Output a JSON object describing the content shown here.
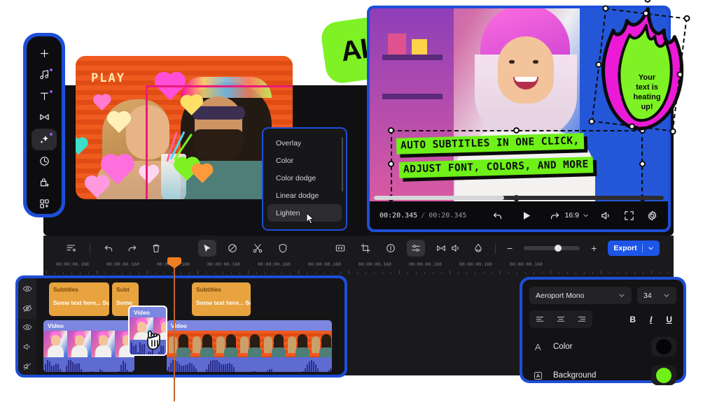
{
  "app": {
    "name": "video-editor"
  },
  "sidebar": {
    "items": [
      {
        "name": "add",
        "icon": "plus-icon"
      },
      {
        "name": "audio",
        "icon": "music-note-icon"
      },
      {
        "name": "titles",
        "icon": "text-icon"
      },
      {
        "name": "transitions",
        "icon": "transitions-icon"
      },
      {
        "name": "effects",
        "icon": "sparkles-icon"
      },
      {
        "name": "speed",
        "icon": "clock-icon"
      },
      {
        "name": "stickers",
        "icon": "sticker-icon"
      },
      {
        "name": "more",
        "icon": "apps-grid-icon"
      }
    ]
  },
  "preview_left": {
    "overlay_text": "PLAY",
    "badge_icon": "sparkle-icon",
    "selection_color": "#ec1a7c"
  },
  "blend_menu": {
    "items": [
      "Overlay",
      "Color",
      "Color dodge",
      "Linear dodge",
      "Lighten"
    ],
    "selected": "Lighten"
  },
  "ai_badge": {
    "label": "AI",
    "color": "#7ef224"
  },
  "sticker": {
    "text_lines": [
      "Your",
      "text is",
      "heating",
      "up!"
    ],
    "fill": "#7ef224",
    "outline": "#ec1ad6"
  },
  "player": {
    "subtitle_lines": [
      "AUTO SUBTITLES IN ONE CLICK,",
      "ADJUST FONT, COLORS, AND MORE"
    ],
    "subtitle_bg": "#6ef018",
    "current_time": "00:20.345",
    "total_time": "00:20.345",
    "separator": "/",
    "progress_percent": 45,
    "aspect_ratio": "16:9",
    "controls": [
      {
        "name": "undo-button",
        "icon": "undo-icon"
      },
      {
        "name": "play-button",
        "icon": "play-icon"
      },
      {
        "name": "redo-button",
        "icon": "redo-icon"
      }
    ],
    "right_controls": [
      {
        "name": "volume-button",
        "icon": "volume-icon"
      },
      {
        "name": "fullscreen-button",
        "icon": "fullscreen-icon"
      },
      {
        "name": "settings-button",
        "icon": "gear-icon"
      }
    ]
  },
  "toolbar": {
    "left": [
      {
        "name": "add-track-button",
        "icon": "add-track-icon"
      },
      {
        "name": "undo-button",
        "icon": "undo-icon"
      },
      {
        "name": "redo-button",
        "icon": "redo-icon"
      },
      {
        "name": "delete-button",
        "icon": "trash-icon"
      }
    ],
    "center": [
      {
        "name": "select-tool",
        "icon": "cursor-icon",
        "active": true
      },
      {
        "name": "disable-tool",
        "icon": "slash-circle-icon"
      },
      {
        "name": "split-tool",
        "icon": "scissors-icon"
      },
      {
        "name": "mask-tool",
        "icon": "shield-icon"
      }
    ],
    "right_group": [
      {
        "name": "captions-button",
        "icon": "closed-caption-icon"
      },
      {
        "name": "crop-button",
        "icon": "crop-icon"
      },
      {
        "name": "info-button",
        "icon": "info-icon"
      },
      {
        "name": "adjust-button",
        "icon": "sliders-icon",
        "active": true
      },
      {
        "name": "transition-button",
        "icon": "transitions-icon"
      }
    ],
    "audio_group": [
      {
        "name": "audio-button",
        "icon": "audio-wave-icon"
      },
      {
        "name": "color-button",
        "icon": "color-drop-icon"
      }
    ],
    "zoom": {
      "minus": "−",
      "plus": "+",
      "value_percent": 55
    },
    "export_label": "Export",
    "export_caret": "chevron-down-icon"
  },
  "ruler": {
    "ticks": [
      "00:00:00.160",
      "00:00:00.160",
      "00:00:00.160",
      "00:00:00.160",
      "00:00:00.160",
      "00:00:00.160",
      "00:00:00.160",
      "00:00:00.160",
      "00:00:00.160",
      "00:00:00.160"
    ]
  },
  "timeline": {
    "tracks": [
      {
        "name": "subtitle-track",
        "header_icons": [
          "eye-icon",
          "eye-off-icon"
        ],
        "clips": [
          {
            "title": "Subtitles",
            "body": "Some text here... Som"
          },
          {
            "title": "Subt",
            "body": "Some"
          },
          {
            "title": "Subtitles",
            "body": "Some text here... So"
          }
        ]
      },
      {
        "name": "video-track",
        "header_icons": [
          "eye-icon",
          "speaker-icon",
          "mic-off-icon"
        ],
        "clips": [
          {
            "title": "Video"
          },
          {
            "title": "Video"
          },
          {
            "title": "Video"
          }
        ]
      }
    ],
    "dragging_clip": {
      "title": "Video",
      "cursor": "grab-hand-cursor"
    }
  },
  "text_panel": {
    "font_family": "Aeroport Mono",
    "font_size": "34",
    "caret_icon": "chevron-down-icon",
    "align_buttons": [
      {
        "name": "align-left-button",
        "icon": "align-left-icon"
      },
      {
        "name": "align-center-button",
        "icon": "align-center-icon"
      },
      {
        "name": "align-right-button",
        "icon": "align-right-icon"
      }
    ],
    "style_buttons": [
      {
        "name": "bold-button",
        "label": "B"
      },
      {
        "name": "italic-button",
        "label": "I"
      },
      {
        "name": "underline-button",
        "label": "U"
      }
    ],
    "rows": [
      {
        "label": "Color",
        "icon": "font-color-icon",
        "swatch": "#050507"
      },
      {
        "label": "Background",
        "icon": "text-background-icon",
        "swatch": "#6ef018"
      }
    ]
  }
}
